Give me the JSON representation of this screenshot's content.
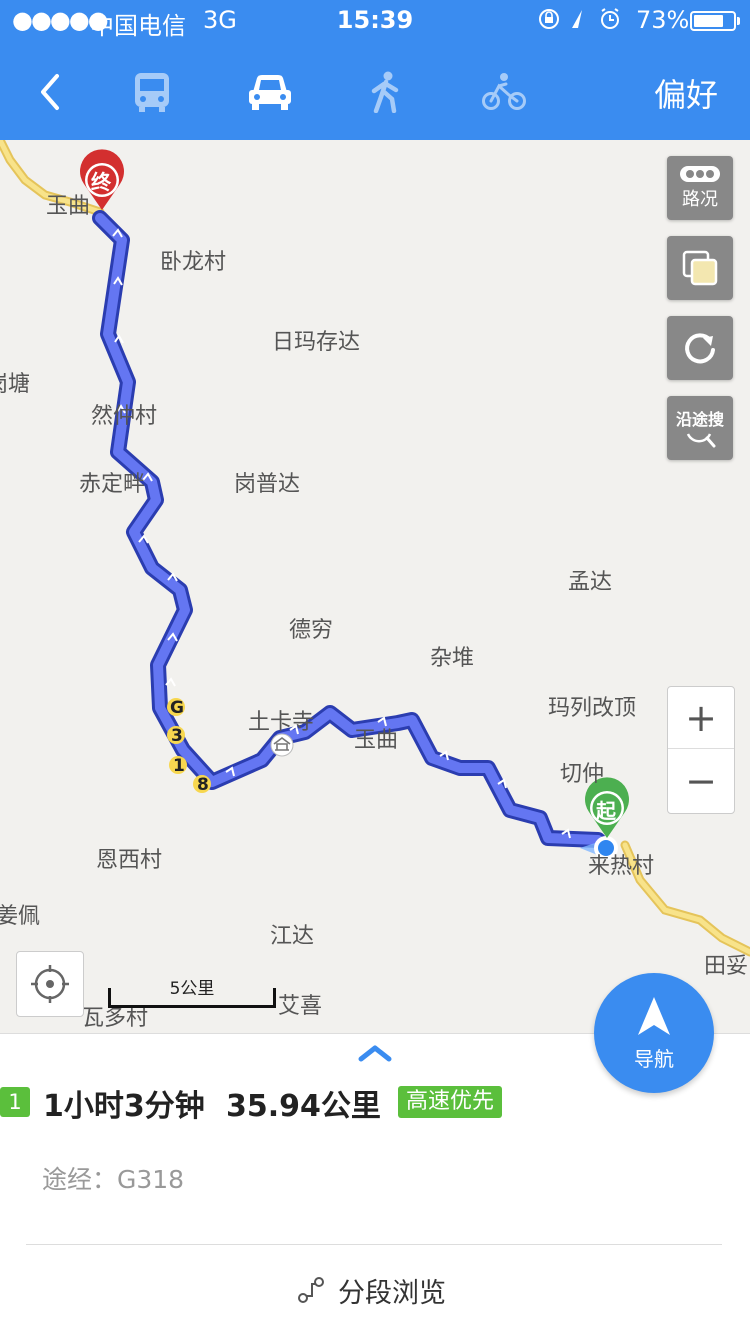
{
  "status_bar": {
    "signal": "●●●●●",
    "carrier": "中国电信",
    "network": "3G",
    "time": "15:39",
    "battery": "73%"
  },
  "toolbar": {
    "modes": [
      {
        "icon": "bus-icon",
        "active": false
      },
      {
        "icon": "car-icon",
        "active": true
      },
      {
        "icon": "walk-icon",
        "active": false
      },
      {
        "icon": "bike-icon",
        "active": false
      }
    ],
    "preference_label": "偏好"
  },
  "map": {
    "places": [
      "玉曲",
      "卧龙村",
      "日玛存达",
      "岗塘",
      "然仲村",
      "赤定畔",
      "岗普达",
      "孟达",
      "德穷",
      "杂堆",
      "玛列改顶",
      "土卡寺",
      "玉曲",
      "切仲",
      "来热村",
      "恩西村",
      "姜佩",
      "江达",
      "田妥",
      "艾喜",
      "瓦多村"
    ],
    "road_label": "G318",
    "end_marker": "终",
    "start_marker": "起",
    "controls": {
      "traffic_label": "路况",
      "search_along_label": "沿途搜"
    },
    "zoom_in": "+",
    "zoom_out": "−",
    "scale_label": "5公里",
    "colors": {
      "route": "#5a6ef0",
      "route_border": "#2b3db0",
      "road": "#f4d97a",
      "end": "#d32f2f",
      "start": "#4caf50"
    }
  },
  "navigation": {
    "label": "导航"
  },
  "route": {
    "index": "1",
    "duration": "1小时3分钟",
    "distance": "35.94公里",
    "tag": "高速优先",
    "via": "途经：G318",
    "segment_label": "分段浏览"
  }
}
